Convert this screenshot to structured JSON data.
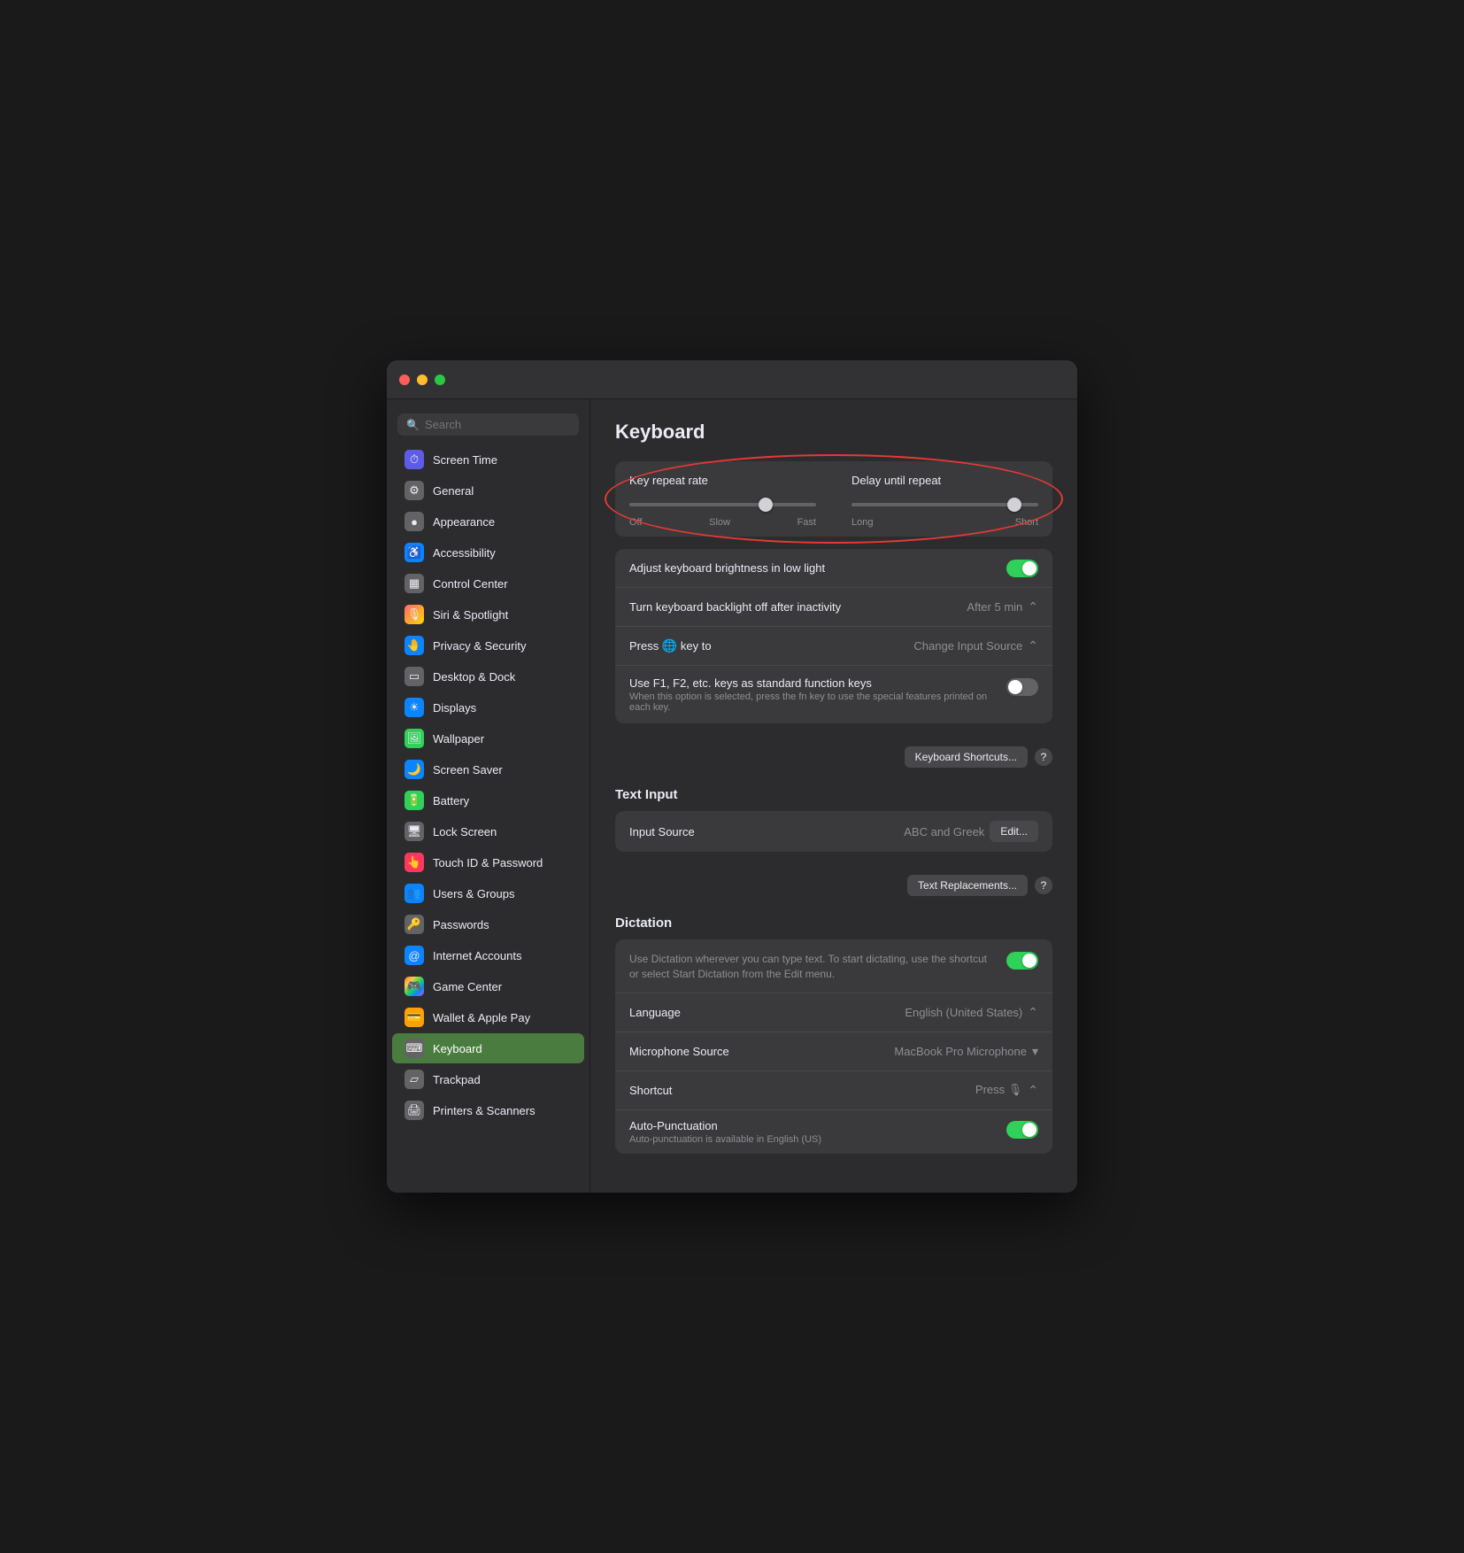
{
  "window": {
    "title": "Keyboard"
  },
  "sidebar": {
    "search_placeholder": "Search",
    "items": [
      {
        "id": "screen-time",
        "label": "Screen Time",
        "icon": "⏱",
        "icon_class": "icon-purple",
        "active": false
      },
      {
        "id": "general",
        "label": "General",
        "icon": "⚙",
        "icon_class": "icon-gray",
        "active": false
      },
      {
        "id": "appearance",
        "label": "Appearance",
        "icon": "●",
        "icon_class": "icon-gray",
        "active": false
      },
      {
        "id": "accessibility",
        "label": "Accessibility",
        "icon": "♿",
        "icon_class": "icon-blue",
        "active": false
      },
      {
        "id": "control-center",
        "label": "Control Center",
        "icon": "▦",
        "icon_class": "icon-gray",
        "active": false
      },
      {
        "id": "siri-spotlight",
        "label": "Siri & Spotlight",
        "icon": "🎙",
        "icon_class": "icon-gradient",
        "active": false
      },
      {
        "id": "privacy-security",
        "label": "Privacy & Security",
        "icon": "🤚",
        "icon_class": "icon-blue",
        "active": false
      },
      {
        "id": "desktop-dock",
        "label": "Desktop & Dock",
        "icon": "▭",
        "icon_class": "icon-gray",
        "active": false
      },
      {
        "id": "displays",
        "label": "Displays",
        "icon": "☀",
        "icon_class": "icon-blue",
        "active": false
      },
      {
        "id": "wallpaper",
        "label": "Wallpaper",
        "icon": "🖼",
        "icon_class": "icon-teal",
        "active": false
      },
      {
        "id": "screen-saver",
        "label": "Screen Saver",
        "icon": "🌙",
        "icon_class": "icon-blue",
        "active": false
      },
      {
        "id": "battery",
        "label": "Battery",
        "icon": "🔋",
        "icon_class": "icon-green",
        "active": false
      },
      {
        "id": "lock-screen",
        "label": "Lock Screen",
        "icon": "🖥",
        "icon_class": "icon-gray",
        "active": false
      },
      {
        "id": "touch-id-password",
        "label": "Touch ID & Password",
        "icon": "👆",
        "icon_class": "icon-pink",
        "active": false
      },
      {
        "id": "users-groups",
        "label": "Users & Groups",
        "icon": "👥",
        "icon_class": "icon-blue",
        "active": false
      },
      {
        "id": "passwords",
        "label": "Passwords",
        "icon": "🔑",
        "icon_class": "icon-gray",
        "active": false
      },
      {
        "id": "internet-accounts",
        "label": "Internet Accounts",
        "icon": "@",
        "icon_class": "icon-blue",
        "active": false
      },
      {
        "id": "game-center",
        "label": "Game Center",
        "icon": "🎮",
        "icon_class": "icon-multi",
        "active": false
      },
      {
        "id": "wallet-apple-pay",
        "label": "Wallet & Apple Pay",
        "icon": "💳",
        "icon_class": "icon-orange",
        "active": false
      },
      {
        "id": "keyboard",
        "label": "Keyboard",
        "icon": "⌨",
        "icon_class": "icon-gray",
        "active": true
      },
      {
        "id": "trackpad",
        "label": "Trackpad",
        "icon": "▱",
        "icon_class": "icon-gray",
        "active": false
      },
      {
        "id": "printers-scanners",
        "label": "Printers & Scanners",
        "icon": "🖨",
        "icon_class": "icon-gray",
        "active": false
      }
    ]
  },
  "main": {
    "title": "Keyboard",
    "key_repeat_rate_label": "Key repeat rate",
    "delay_until_repeat_label": "Delay until repeat",
    "repeat_slider_min_label": "Off",
    "repeat_slider_slow_label": "Slow",
    "repeat_slider_fast_label": "Fast",
    "repeat_slider_value": 75,
    "delay_slider_long_label": "Long",
    "delay_slider_short_label": "Short",
    "delay_slider_value": 90,
    "adjust_brightness_label": "Adjust keyboard brightness in low light",
    "adjust_brightness_toggle": "on",
    "backlight_off_label": "Turn keyboard backlight off after inactivity",
    "backlight_off_value": "After 5 min",
    "press_key_label": "Press",
    "press_key_globe": "🌐",
    "press_key_suffix": "key to",
    "press_key_value": "Change Input Source",
    "fn_keys_label": "Use F1, F2, etc. keys as standard function keys",
    "fn_keys_sub": "When this option is selected, press the fn key to use the special features printed on each key.",
    "fn_keys_toggle": "off",
    "keyboard_shortcuts_btn": "Keyboard Shortcuts...",
    "help_btn": "?",
    "text_input_header": "Text Input",
    "input_source_label": "Input Source",
    "input_source_value": "ABC and Greek",
    "input_source_edit_btn": "Edit...",
    "text_replacements_btn": "Text Replacements...",
    "text_replacements_help": "?",
    "dictation_header": "Dictation",
    "dictation_description": "Use Dictation wherever you can type text. To start dictating, use the shortcut or select Start Dictation from the Edit menu.",
    "dictation_toggle": "on",
    "language_label": "Language",
    "language_value": "English (United States)",
    "microphone_source_label": "Microphone Source",
    "microphone_source_value": "MacBook Pro Microphone",
    "shortcut_label": "Shortcut",
    "shortcut_value": "Press",
    "shortcut_mic": "🎙",
    "auto_punctuation_label": "Auto-Punctuation",
    "auto_punctuation_sub": "Auto-punctuation is available in English (US)",
    "auto_punctuation_toggle": "on"
  }
}
